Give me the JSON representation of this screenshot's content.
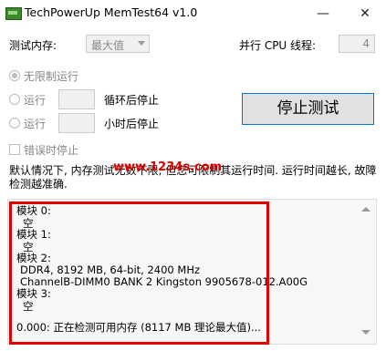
{
  "window": {
    "title": "TechPowerUp MemTest64 v1.0",
    "minimize_glyph": "—",
    "close_glyph": "✕"
  },
  "settings": {
    "memory_label": "测试内存:",
    "memory_value": "最大值",
    "cpu_threads_label": "并行 CPU 线程:",
    "cpu_threads_value": "4"
  },
  "mode": {
    "unlimited_label": "无限制运行",
    "run_label_1": "运行",
    "loop_stop_label": "循环后停止",
    "run_label_2": "运行",
    "hours_stop_label": "小时后停止",
    "stop_on_error_label": "错误时停止"
  },
  "stop_button_label": "停止测试",
  "info_text": {
    "line1": "默认情况下, 内存测试无数不限, 但您可限制其运行时间. 运行时间越长, 故障",
    "line2": "检测越准确."
  },
  "watermark": "www.1234s.com",
  "log": {
    "lines": [
      "模块 0:",
      "空",
      "模块 1:",
      "空",
      "模块 2:",
      "DDR4, 8192 MB, 64-bit, 2400 MHz",
      "ChannelB-DIMM0 BANK 2 Kingston 9905678-012.A00G",
      "模块 3:",
      "空",
      "0.000: 正在检测可用内存 (8117 MB 理论最大值)..."
    ]
  }
}
